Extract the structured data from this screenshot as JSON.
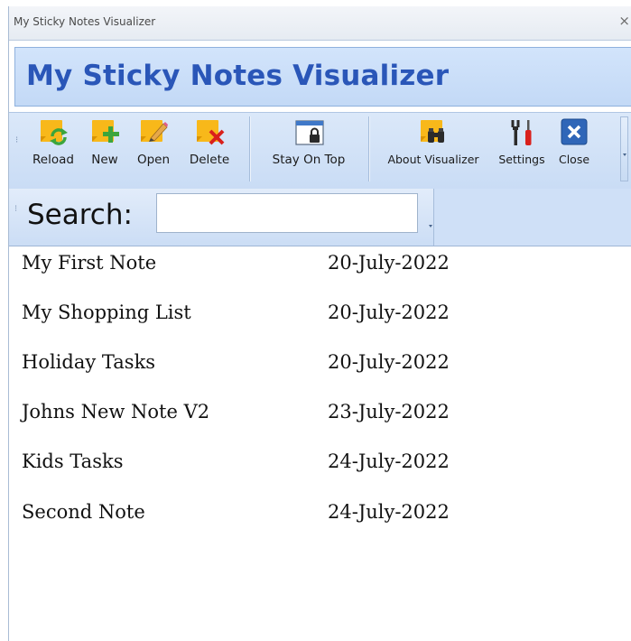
{
  "window": {
    "title": "My Sticky Notes Visualizer",
    "close_glyph": "×"
  },
  "header": {
    "title": "My Sticky Notes Visualizer"
  },
  "toolbar": {
    "buttons": [
      {
        "label": "Reload",
        "icon": "reload-icon"
      },
      {
        "label": "New",
        "icon": "new-note-icon"
      },
      {
        "label": "Open",
        "icon": "open-note-icon"
      },
      {
        "label": "Delete",
        "icon": "delete-note-icon"
      },
      {
        "label": "Stay On Top",
        "icon": "stay-on-top-icon"
      },
      {
        "label": "About Visualizer",
        "icon": "binoculars-icon"
      },
      {
        "label": "Settings",
        "icon": "tools-icon"
      },
      {
        "label": "Close",
        "icon": "close-icon"
      }
    ]
  },
  "search": {
    "label": "Search:",
    "value": "",
    "placeholder": ""
  },
  "notes": [
    {
      "name": "My First Note",
      "date": "20-July-2022"
    },
    {
      "name": "My Shopping List",
      "date": "20-July-2022"
    },
    {
      "name": "Holiday Tasks",
      "date": "20-July-2022"
    },
    {
      "name": "Johns New Note V2",
      "date": "23-July-2022"
    },
    {
      "name": "Kids Tasks",
      "date": "24-July-2022"
    },
    {
      "name": "Second Note",
      "date": "24-July-2022"
    }
  ],
  "colors": {
    "title_text": "#2a56b8",
    "note_yellow": "#f8b81a",
    "reload_green": "#3ca53c",
    "delete_red": "#d9201c",
    "close_blue": "#2f66b8",
    "header_bg": "#c3d9f6"
  }
}
